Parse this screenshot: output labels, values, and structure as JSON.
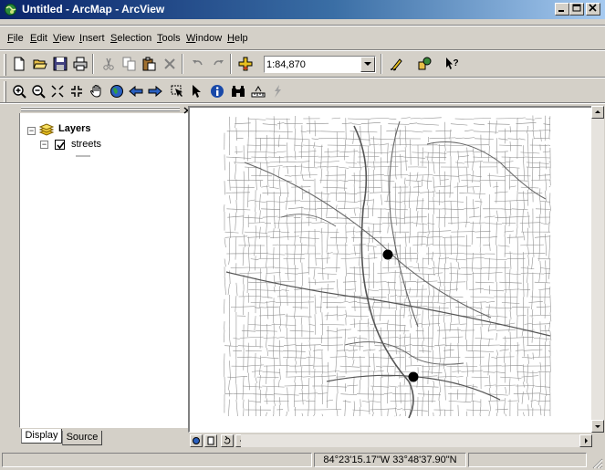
{
  "window": {
    "title": "Untitled - ArcMap - ArcView",
    "controls": [
      "minimize",
      "maximize",
      "close"
    ]
  },
  "menu": {
    "items": [
      {
        "label": "File",
        "accel": "F",
        "rest": "ile"
      },
      {
        "label": "Edit",
        "accel": "E",
        "rest": "dit"
      },
      {
        "label": "View",
        "accel": "V",
        "rest": "iew"
      },
      {
        "label": "Insert",
        "accel": "I",
        "rest": "nsert"
      },
      {
        "label": "Selection",
        "accel": "S",
        "rest": "election"
      },
      {
        "label": "Tools",
        "accel": "T",
        "rest": "ools"
      },
      {
        "label": "Window",
        "accel": "W",
        "rest": "indow"
      },
      {
        "label": "Help",
        "accel": "H",
        "rest": "elp"
      }
    ]
  },
  "standard_toolbar": {
    "scale_value": "1:84,870"
  },
  "toc": {
    "root_label": "Layers",
    "layer_label": "streets",
    "layer_checked": true,
    "tabs": [
      "Display",
      "Source"
    ],
    "active_tab": "Display"
  },
  "map": {
    "points_count": 2
  },
  "status": {
    "coordinates": "84°23'15.17\"W  33°48'37.90\"N"
  },
  "colors": {
    "title_start": "#0a246a",
    "title_end": "#a6caf0",
    "face": "#d4d0c8"
  }
}
